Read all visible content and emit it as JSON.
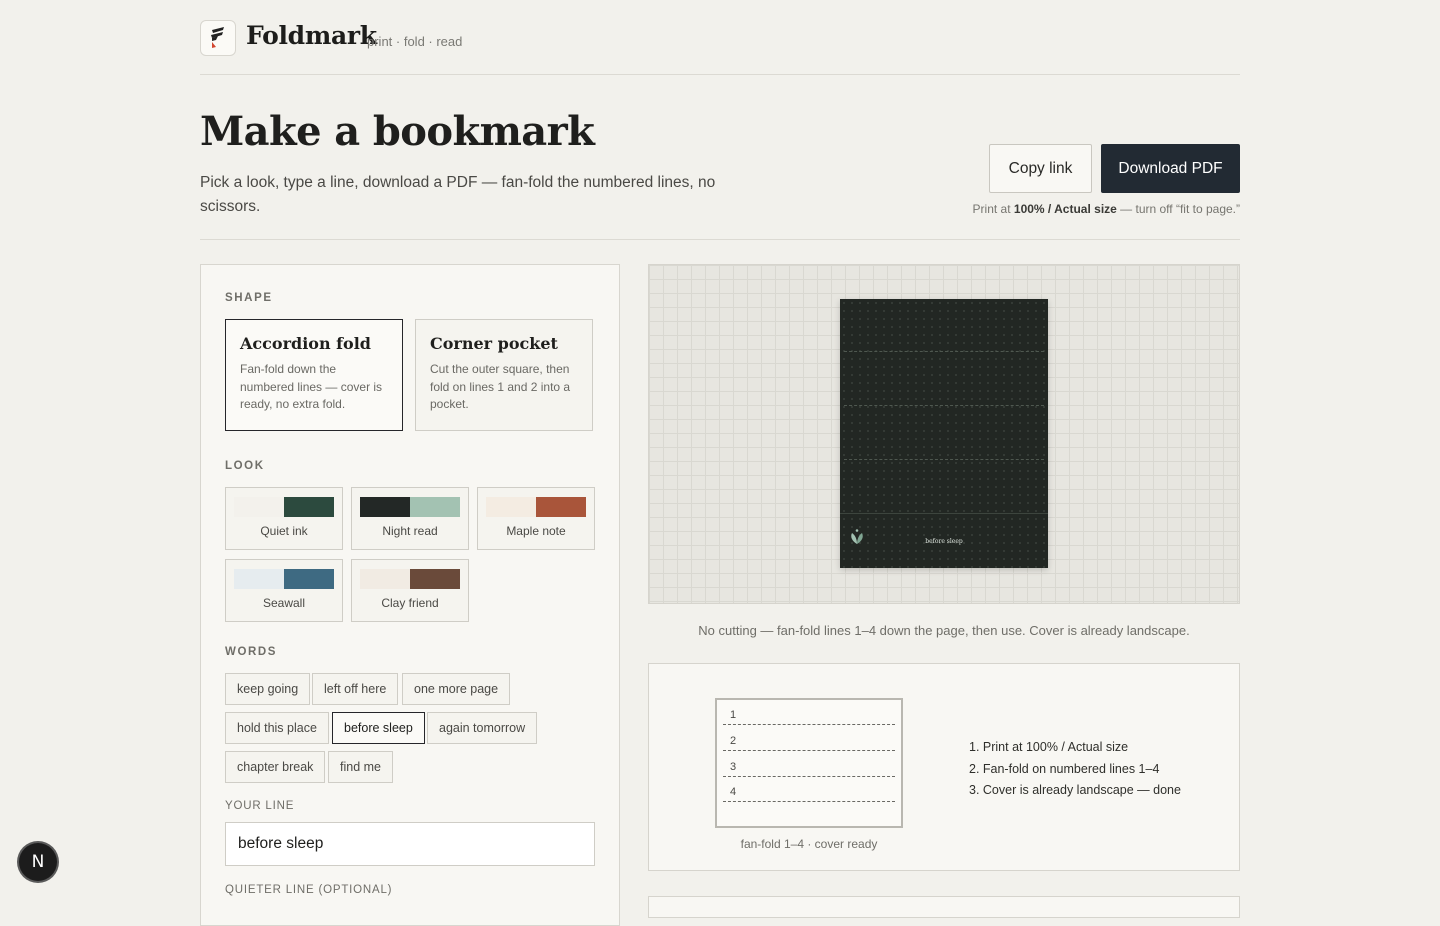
{
  "header": {
    "brand": "Foldmark",
    "tagline": "print · fold · read",
    "logo_icon": "flag-logo-icon"
  },
  "hero": {
    "title": "Make a bookmark",
    "subtitle": "Pick a look, type a line, download a PDF — fan-fold the numbered lines, no scissors.",
    "copy_link_label": "Copy link",
    "download_label": "Download PDF",
    "print_note_prefix": "Print at ",
    "print_note_bold": "100% / Actual size",
    "print_note_suffix": " — turn off “fit to page.”"
  },
  "panel": {
    "shape_label": "SHAPE",
    "shapes": [
      {
        "title": "Accordion fold",
        "desc": "Fan-fold down the numbered lines — cover is ready, no extra fold.",
        "selected": true
      },
      {
        "title": "Corner pocket",
        "desc": "Cut the outer square, then fold on lines 1 and 2 into a pocket.",
        "selected": false
      }
    ],
    "look_label": "LOOK",
    "looks": [
      {
        "name": "Quiet ink",
        "colors": [
          "#f3f1ec",
          "#2c4a3e"
        ]
      },
      {
        "name": "Night read",
        "colors": [
          "#232826",
          "#a3c2b2"
        ]
      },
      {
        "name": "Maple note",
        "colors": [
          "#f4ece2",
          "#a9553a"
        ]
      },
      {
        "name": "Seawall",
        "colors": [
          "#e6ecef",
          "#3e6a82"
        ]
      },
      {
        "name": "Clay friend",
        "colors": [
          "#f1ebe3",
          "#6a4a3a"
        ]
      }
    ],
    "words_label": "WORDS",
    "words": [
      "keep going",
      "left off here",
      "one more page",
      "hold this place",
      "before sleep",
      "again tomorrow",
      "chapter break",
      "find me"
    ],
    "selected_word": "before sleep",
    "your_line_label": "YOUR LINE",
    "your_line_value": "before sleep",
    "quieter_line_label": "QUIETER LINE (OPTIONAL)"
  },
  "preview": {
    "cover_text": "before sleep",
    "caption": "No cutting — fan-fold lines 1–4 down the page, then use. Cover is already landscape.",
    "leaf_icon": "leaf-icon"
  },
  "instructions": {
    "fold_numbers": [
      "1",
      "2",
      "3",
      "4"
    ],
    "diagram_caption": "fan-fold 1–4 · cover ready",
    "steps": [
      "1. Print at 100% / Actual size",
      "2. Fan-fold on numbered lines 1–4",
      "3. Cover is already landscape — done"
    ]
  },
  "badge": {
    "letter": "N"
  }
}
